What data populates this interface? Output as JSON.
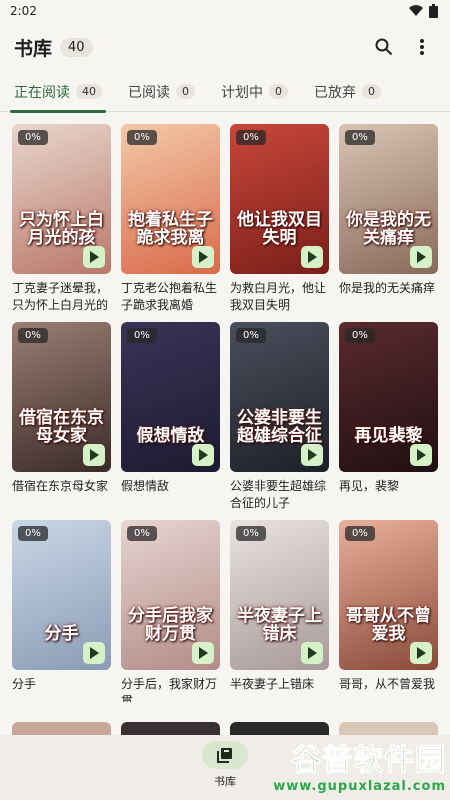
{
  "status": {
    "time": "2:02"
  },
  "appbar": {
    "title": "书库",
    "count": "40"
  },
  "tabs": [
    {
      "label": "正在阅读",
      "count": "40"
    },
    {
      "label": "已阅读",
      "count": "0"
    },
    {
      "label": "计划中",
      "count": "0"
    },
    {
      "label": "已放弃",
      "count": "0"
    }
  ],
  "books": [
    {
      "title": "丁克妻子迷晕我，只为怀上白月光的孩子",
      "progress": "0%",
      "cover_text": "只为怀上白月光的孩",
      "colors": [
        "#e8d6cc",
        "#b9786a"
      ]
    },
    {
      "title": "丁克老公抱着私生子跪求我离婚",
      "progress": "0%",
      "cover_text": "抱着私生子跪求我离",
      "colors": [
        "#f2c9a8",
        "#d96a4a"
      ]
    },
    {
      "title": "为救白月光，他让我双目失明",
      "progress": "0%",
      "cover_text": "他让我双目失明",
      "colors": [
        "#c9463a",
        "#7a1f1a"
      ]
    },
    {
      "title": "你是我的无关痛痒",
      "progress": "0%",
      "cover_text": "你是我的无关痛痒",
      "colors": [
        "#d8c4b4",
        "#8a6a5a"
      ]
    },
    {
      "title": "借宿在东京母女家",
      "progress": "0%",
      "cover_text": "借宿在东京母女家",
      "colors": [
        "#9a7f74",
        "#3b2b28"
      ]
    },
    {
      "title": "假想情敌",
      "progress": "0%",
      "cover_text": "假想情敌",
      "colors": [
        "#3a3458",
        "#1c1a30"
      ]
    },
    {
      "title": "公婆非要生超雄综合征的儿子",
      "progress": "0%",
      "cover_text": "公婆非要生超雄综合征",
      "colors": [
        "#4a4f5c",
        "#1d2028"
      ]
    },
    {
      "title": "再见，裴黎",
      "progress": "0%",
      "cover_text": "再见裴黎",
      "colors": [
        "#5a2a2e",
        "#1f0f12"
      ]
    },
    {
      "title": "分手",
      "progress": "0%",
      "cover_text": "分手",
      "colors": [
        "#c9d6e6",
        "#8a9cb5"
      ]
    },
    {
      "title": "分手后，我家财万贯",
      "progress": "0%",
      "cover_text": "分手后我家财万贯",
      "colors": [
        "#e6d4d0",
        "#b38c88"
      ]
    },
    {
      "title": "半夜妻子上错床",
      "progress": "0%",
      "cover_text": "半夜妻子上错床",
      "colors": [
        "#e8e2e0",
        "#a89a98"
      ]
    },
    {
      "title": "哥哥，从不曾爱我",
      "progress": "0%",
      "cover_text": "哥哥从不曾爱我",
      "colors": [
        "#e8b09a",
        "#8a4a3a"
      ]
    }
  ],
  "bottom_nav": {
    "label": "书库"
  },
  "watermark": {
    "main": "谷普软件园",
    "sub": "www.gupuxlazal.com"
  },
  "accent": "#2e6b3e"
}
